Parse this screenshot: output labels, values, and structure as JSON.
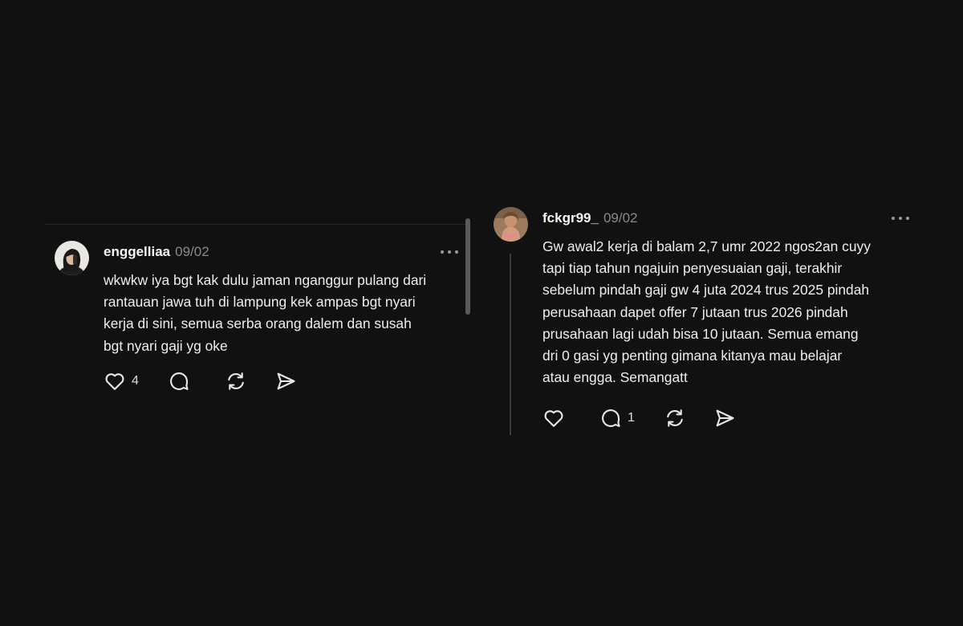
{
  "colors": {
    "background": "#111111",
    "text": "#f3f3f3",
    "muted": "#8a8a8a",
    "icon": "#e8e8e8"
  },
  "posts": [
    {
      "username": "enggelliaa",
      "timestamp": "09/02",
      "avatar_icon": "profile-photo",
      "more_icon": "more-horizontal-icon",
      "body_lines": [
        "wkwkw iya bgt kak dulu jaman nganggur pulang dari",
        "rantauan jawa tuh di lampung kek ampas bgt nyari",
        "kerja di sini, semua serba orang dalem dan susah",
        "bgt nyari gaji yg oke"
      ],
      "actions": {
        "like_count": "4",
        "reply_count": "",
        "like_icon": "heart-icon",
        "reply_icon": "comment-icon",
        "repost_icon": "repost-icon",
        "share_icon": "send-icon"
      }
    },
    {
      "username": "fckgr99_",
      "timestamp": "09/02",
      "avatar_icon": "profile-photo",
      "more_icon": "more-horizontal-icon",
      "body_lines": [
        "Gw awal2 kerja di balam 2,7 umr 2022 ngos2an cuyy",
        "tapi tiap tahun ngajuin penyesuaian gaji, terakhir",
        "sebelum pindah gaji gw 4 juta 2024 trus 2025 pindah",
        "perusahaan dapet offer 7 jutaan trus 2026 pindah",
        "prusahaan lagi udah bisa 10 jutaan. Semua emang",
        "dri 0 gasi yg penting gimana kitanya mau belajar",
        "atau engga. Semangatt"
      ],
      "actions": {
        "like_count": "",
        "reply_count": "1",
        "like_icon": "heart-icon",
        "reply_icon": "comment-icon",
        "repost_icon": "repost-icon",
        "share_icon": "send-icon"
      }
    }
  ]
}
